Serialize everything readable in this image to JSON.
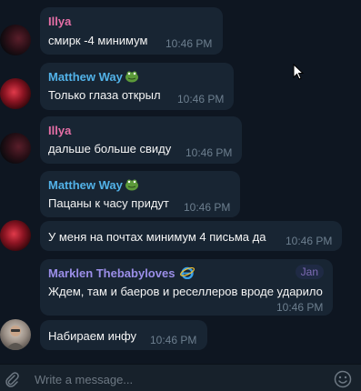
{
  "messages": [
    {
      "sender": "Illya",
      "sender_color": "#e56fa6",
      "text": "смирк -4 минимум",
      "time": "10:46 PM",
      "avatar": "dark"
    },
    {
      "sender": "Matthew Way",
      "sender_color": "#52b2e8",
      "text": "Только глаза открыл",
      "time": "10:46 PM",
      "avatar": "red",
      "emoji": "frog-emoji"
    },
    {
      "sender": "Illya",
      "sender_color": "#e56fa6",
      "text": "дальше больше свиду",
      "time": "10:46 PM",
      "avatar": "dark"
    },
    {
      "sender": "Matthew Way",
      "sender_color": "#52b2e8",
      "text": "Пацаны к часу придут",
      "time": "10:46 PM",
      "avatar": "none",
      "emoji": "frog-emoji"
    },
    {
      "sender": "",
      "text": "У меня на почтах минимум 4 письма да",
      "time": "10:46 PM",
      "avatar": "red"
    },
    {
      "sender": "Marklen Thebabyloves",
      "sender_color": "#9b8ee8",
      "text": "Ждем, там и баеров и реселлеров вроде ударило",
      "time": "10:46 PM",
      "avatar": "none",
      "emoji": "ie-logo-icon",
      "tag": "Jan"
    },
    {
      "sender": "",
      "text": "Набираем инфу",
      "time": "10:46 PM",
      "avatar": "photo"
    }
  ],
  "composer": {
    "placeholder": "Write a message..."
  },
  "colors": {
    "background": "#0e1621",
    "bubble": "#182533",
    "composer": "#17212b",
    "time": "#6d7f8f"
  }
}
